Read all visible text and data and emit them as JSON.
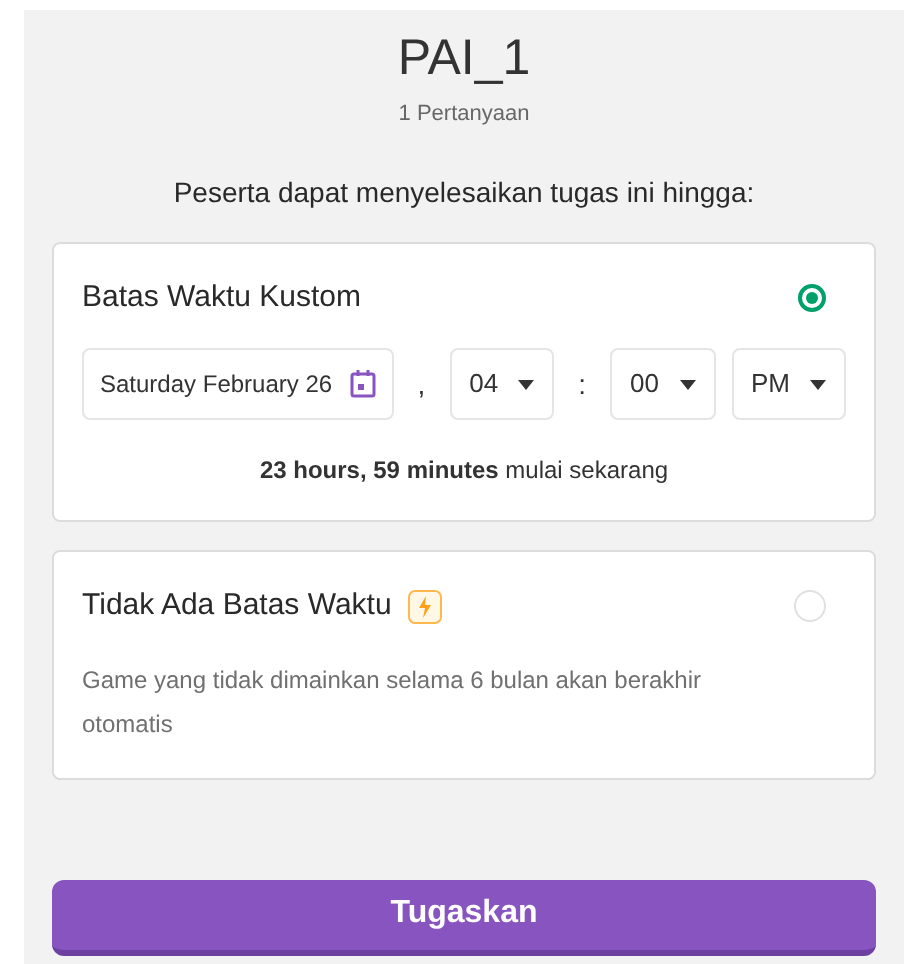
{
  "header": {
    "title": "PAI_1",
    "subtitle": "1 Pertanyaan"
  },
  "prompt": "Peserta dapat menyelesaikan tugas ini hingga:",
  "options": [
    {
      "kind": "custom",
      "title": "Batas Waktu Kustom",
      "selected": true,
      "date": "Saturday February 26",
      "separator_1": ",",
      "hour": "04",
      "separator_2": ":",
      "minute": "00",
      "period": "PM",
      "duration": "23 hours, 59 minutes",
      "duration_suffix": "mulai sekarang"
    },
    {
      "kind": "none",
      "title": "Tidak Ada Batas Waktu",
      "selected": false,
      "description": "Game yang tidak dimainkan selama 6 bulan akan berakhir otomatis"
    }
  ],
  "submit_button": "Tugaskan"
}
